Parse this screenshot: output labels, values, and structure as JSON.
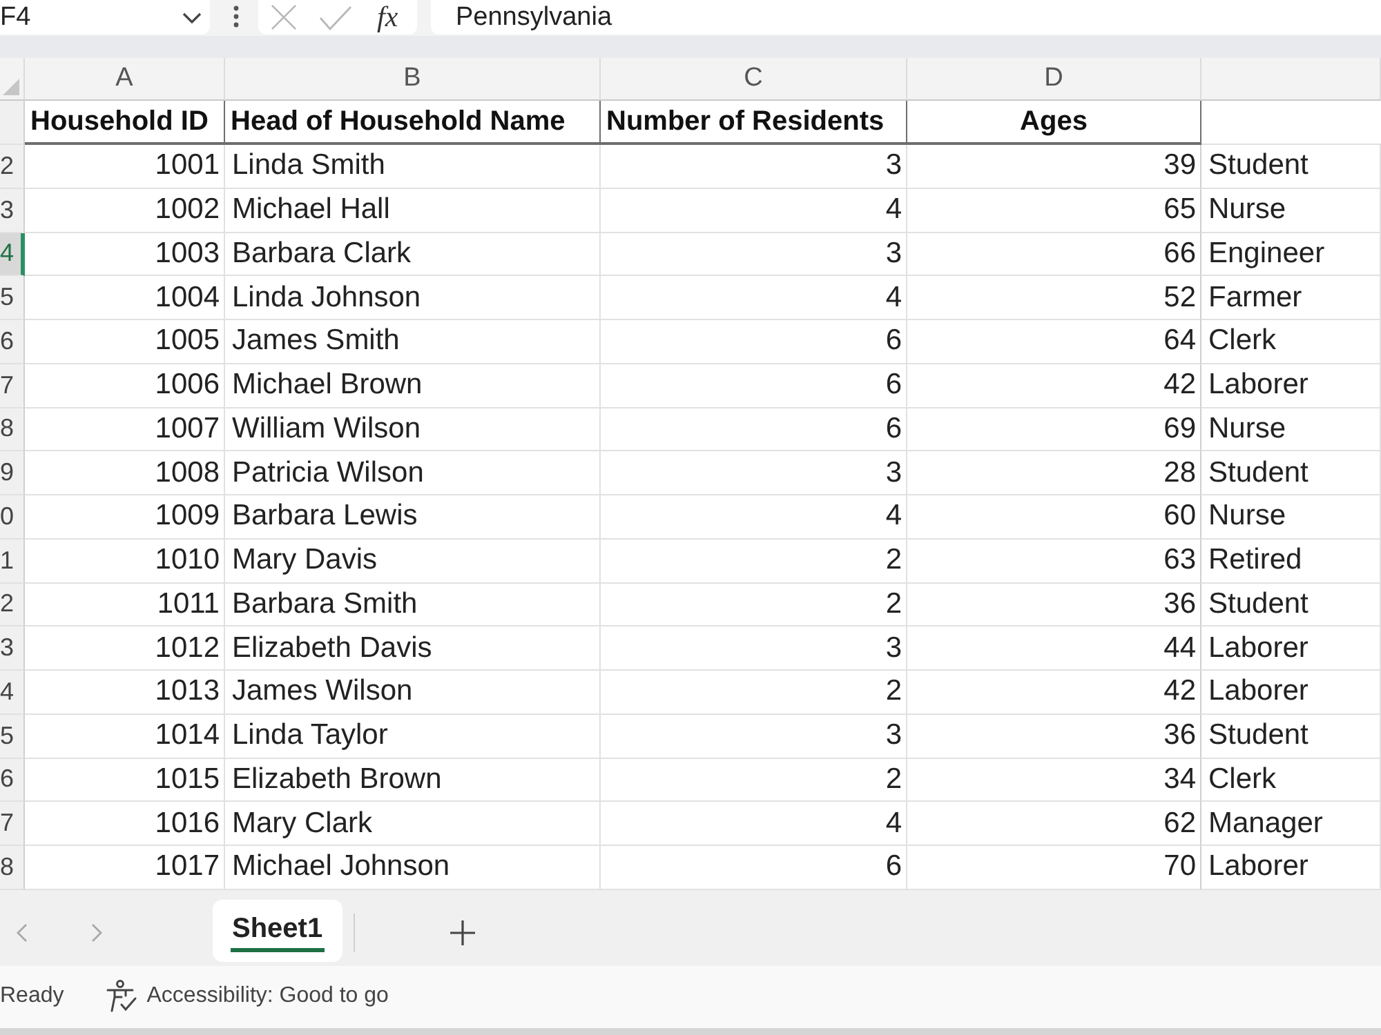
{
  "formula_bar": {
    "name_box": "F4",
    "function_label": "fx",
    "formula": "Pennsylvania"
  },
  "sheet": {
    "column_letters": [
      "A",
      "B",
      "C",
      "D"
    ],
    "header_row": {
      "cells": [
        "Household ID",
        "Head of Household Name",
        "Number of Residents",
        "Ages"
      ]
    },
    "rows": [
      {
        "number": "2",
        "selected": false,
        "cells": [
          "1001",
          "Linda Smith",
          "3",
          "39",
          "Student"
        ]
      },
      {
        "number": "3",
        "selected": false,
        "cells": [
          "1002",
          "Michael Hall",
          "4",
          "65",
          "Nurse"
        ]
      },
      {
        "number": "4",
        "selected": true,
        "cells": [
          "1003",
          "Barbara Clark",
          "3",
          "66",
          "Engineer"
        ]
      },
      {
        "number": "5",
        "selected": false,
        "cells": [
          "1004",
          "Linda Johnson",
          "4",
          "52",
          "Farmer"
        ]
      },
      {
        "number": "6",
        "selected": false,
        "cells": [
          "1005",
          "James Smith",
          "6",
          "64",
          "Clerk"
        ]
      },
      {
        "number": "7",
        "selected": false,
        "cells": [
          "1006",
          "Michael Brown",
          "6",
          "42",
          "Laborer"
        ]
      },
      {
        "number": "8",
        "selected": false,
        "cells": [
          "1007",
          "William Wilson",
          "6",
          "69",
          "Nurse"
        ]
      },
      {
        "number": "9",
        "selected": false,
        "cells": [
          "1008",
          "Patricia Wilson",
          "3",
          "28",
          "Student"
        ]
      },
      {
        "number": "0",
        "selected": false,
        "cells": [
          "1009",
          "Barbara Lewis",
          "4",
          "60",
          "Nurse"
        ]
      },
      {
        "number": "1",
        "selected": false,
        "cells": [
          "1010",
          "Mary Davis",
          "2",
          "63",
          "Retired"
        ]
      },
      {
        "number": "2",
        "selected": false,
        "cells": [
          "1011",
          "Barbara Smith",
          "2",
          "36",
          "Student"
        ]
      },
      {
        "number": "3",
        "selected": false,
        "cells": [
          "1012",
          "Elizabeth Davis",
          "3",
          "44",
          "Laborer"
        ]
      },
      {
        "number": "4",
        "selected": false,
        "cells": [
          "1013",
          "James Wilson",
          "2",
          "42",
          "Laborer"
        ]
      },
      {
        "number": "5",
        "selected": false,
        "cells": [
          "1014",
          "Linda Taylor",
          "3",
          "36",
          "Student"
        ]
      },
      {
        "number": "6",
        "selected": false,
        "cells": [
          "1015",
          "Elizabeth Brown",
          "2",
          "34",
          "Clerk"
        ]
      },
      {
        "number": "7",
        "selected": false,
        "cells": [
          "1016",
          "Mary Clark",
          "4",
          "62",
          "Manager"
        ]
      },
      {
        "number": "8",
        "selected": false,
        "cells": [
          "1017",
          "Michael Johnson",
          "6",
          "70",
          "Laborer"
        ]
      }
    ]
  },
  "tabs": [
    {
      "label": "Sheet1",
      "selected": true
    }
  ],
  "status_bar": {
    "mode": "Ready",
    "accessibility": "Accessibility: Good to go"
  }
}
